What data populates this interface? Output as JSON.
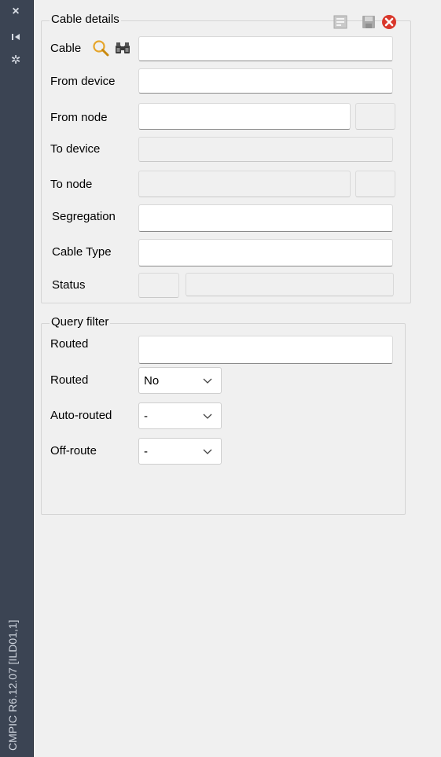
{
  "sidebar": {
    "title": "CMPIC R6.12.07 [ILD01,1]",
    "close_glyph": "×",
    "pin_glyph": "⇥",
    "gear_glyph": "✲"
  },
  "cable_details": {
    "legend": "Cable details",
    "cable_label": "Cable",
    "from_device_label": "From device",
    "from_node_label": "From node",
    "to_device_label": "To device",
    "to_node_label": "To node",
    "segregation_label": "Segregation",
    "cable_type_label": "Cable Type",
    "status_label": "Status",
    "cable_value": "",
    "from_device_value": "",
    "from_node_value": "",
    "segregation_value": "",
    "cable_type_value": ""
  },
  "query_filter": {
    "legend": "Query filter",
    "routed_text_label": "Routed",
    "routed_text_value": "",
    "routed_label": "Routed",
    "routed_value": "No",
    "auto_routed_label": "Auto-routed",
    "auto_routed_value": "-",
    "off_route_label": "Off-route",
    "off_route_value": "-"
  },
  "colors": {
    "sidebar_bg": "#3b4453",
    "panel_bg": "#f0f0f0",
    "close_red": "#d9372b"
  }
}
